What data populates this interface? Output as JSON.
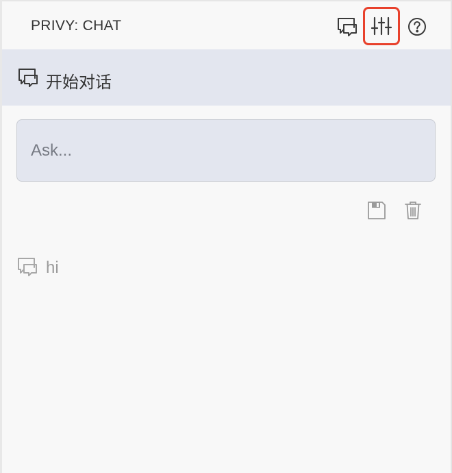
{
  "header": {
    "title": "PRIVY: CHAT",
    "buttons": [
      {
        "icon": "new-chat-icon"
      },
      {
        "icon": "sliders-icon"
      },
      {
        "icon": "help-circle-icon"
      }
    ],
    "highlight_color": "#e8412c"
  },
  "section": {
    "icon": "chat-bubbles-icon",
    "label": "开始对话"
  },
  "input": {
    "placeholder": "Ask..."
  },
  "actions": [
    {
      "icon": "save-icon"
    },
    {
      "icon": "trash-icon"
    }
  ],
  "conversations": [
    {
      "icon": "chat-bubbles-icon",
      "label": "hi"
    }
  ]
}
